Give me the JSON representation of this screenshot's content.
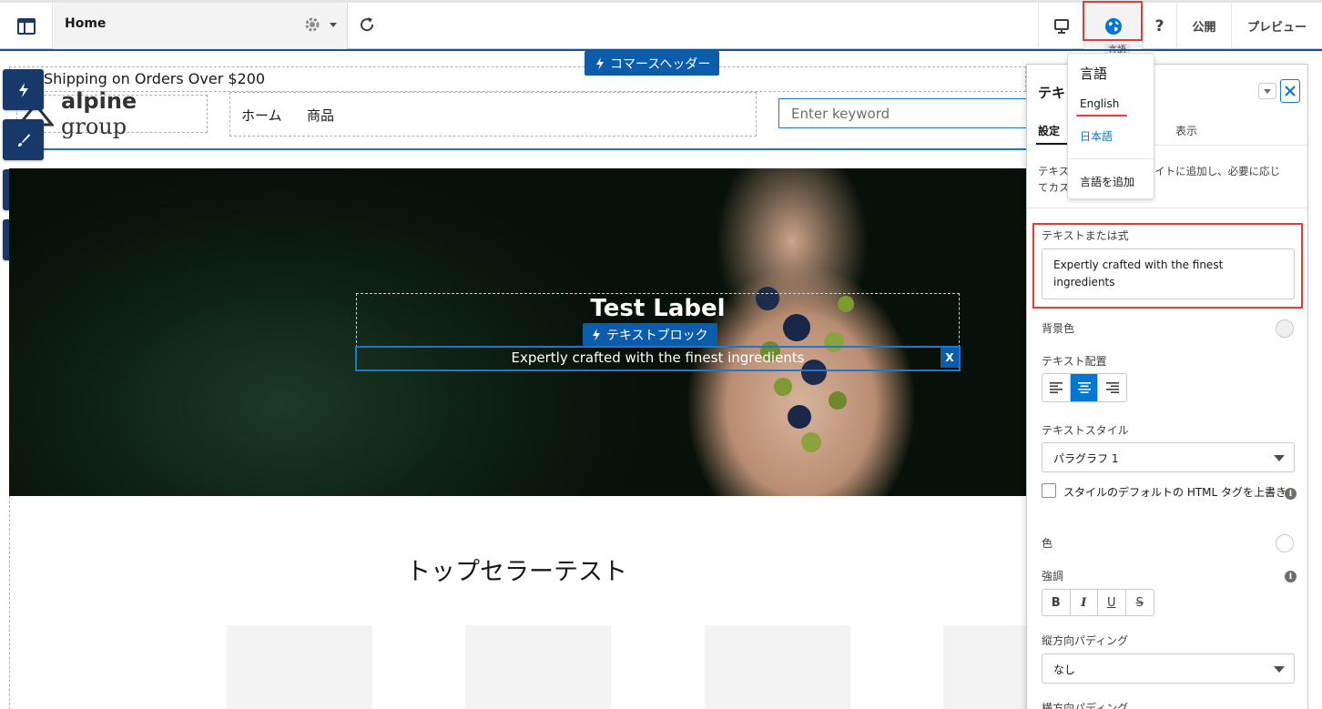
{
  "toolbar": {
    "page_name": "Home",
    "publish_label": "公開",
    "preview_label": "プレビュー",
    "help_label": "?",
    "language_tooltip": "言語"
  },
  "canvas": {
    "header_tag": "コマースヘッダー",
    "shipping_text": "Shipping on Orders Over $200",
    "logo_bold": "alpine",
    "logo_rest": " group",
    "nav_items": [
      "ホーム",
      "商品"
    ],
    "search_placeholder": "Enter keyword",
    "hero": {
      "title": "Test Label",
      "textblock_tag": "テキストブロック",
      "text": "Expertly crafted with the finest ingredients",
      "close_label": "X"
    },
    "section_title": "トップセラーテスト"
  },
  "panel": {
    "title": "テキ",
    "tabs": [
      "設定",
      "表示"
    ],
    "description": "テキストブロックをサイトに追加し、必要に応じてカスタマイズします。",
    "description_visible_line1_start": "テキス",
    "description_visible_line1_end": "イトに追加し、必要に応じ",
    "description_visible_line2": "てカス",
    "text_field_label": "テキストまたは式",
    "text_field_value": "Expertly crafted with the finest ingredients",
    "background_color_label": "背景色",
    "text_align_label": "テキスト配置",
    "text_style_label": "テキストスタイル",
    "text_style_value": "パラグラフ 1",
    "override_label": "スタイルのデフォルトの HTML タグを上書き",
    "color_label": "色",
    "emphasis_label": "強調",
    "emphasis_buttons": [
      "B",
      "I",
      "U",
      "S"
    ],
    "vertical_padding_label": "縦方向パディング",
    "vertical_padding_value": "なし",
    "horizontal_padding_label": "横方向パディング"
  },
  "language_menu": {
    "header": "言語",
    "items": [
      "English",
      "日本語"
    ],
    "add_language": "言語を追加"
  },
  "colors": {
    "brand_dark": "#173a6b",
    "accent_blue": "#0176d3",
    "highlight_red": "#e23b3b"
  }
}
